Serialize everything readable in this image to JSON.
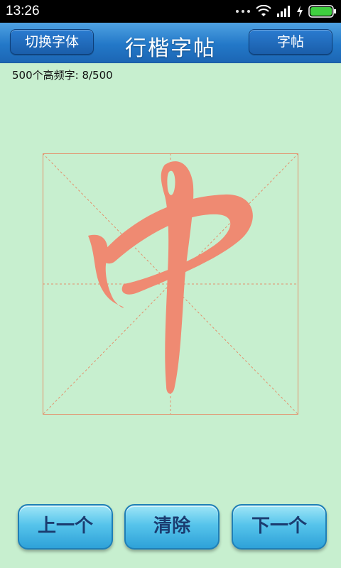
{
  "status_bar": {
    "time": "13:26"
  },
  "header": {
    "title": "行楷字帖",
    "switch_font_label": "切换字体",
    "copybook_label": "字帖"
  },
  "info": {
    "progress_text": "500个高频字: 8/500"
  },
  "practice": {
    "character": "中",
    "stroke_color": "#ef8a72",
    "guide_color": "#e3906c"
  },
  "footer": {
    "prev_label": "上一个",
    "clear_label": "清除",
    "next_label": "下一个"
  }
}
